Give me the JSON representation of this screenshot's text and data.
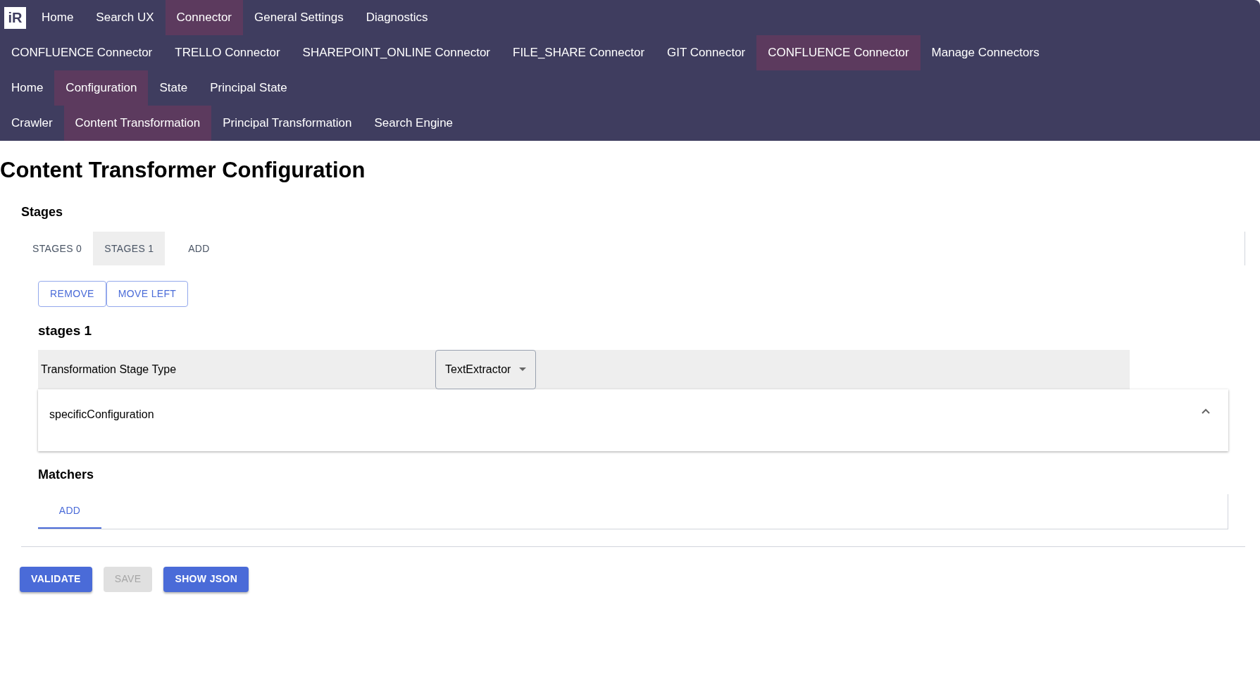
{
  "logo": {
    "text": "iR"
  },
  "nav_rows": [
    [
      {
        "label": "Home",
        "selected": false
      },
      {
        "label": "Search UX",
        "selected": false
      },
      {
        "label": "Connector",
        "selected": true
      },
      {
        "label": "General Settings",
        "selected": false
      },
      {
        "label": "Diagnostics",
        "selected": false
      }
    ],
    [
      {
        "label": "CONFLUENCE Connector",
        "selected": false
      },
      {
        "label": "TRELLO Connector",
        "selected": false
      },
      {
        "label": "SHAREPOINT_ONLINE Connector",
        "selected": false
      },
      {
        "label": "FILE_SHARE Connector",
        "selected": false
      },
      {
        "label": "GIT Connector",
        "selected": false
      },
      {
        "label": "CONFLUENCE Connector",
        "selected": true
      },
      {
        "label": "Manage Connectors",
        "selected": false
      }
    ],
    [
      {
        "label": "Home",
        "selected": false
      },
      {
        "label": "Configuration",
        "selected": true
      },
      {
        "label": "State",
        "selected": false
      },
      {
        "label": "Principal State",
        "selected": false
      }
    ],
    [
      {
        "label": "Crawler",
        "selected": false
      },
      {
        "label": "Content Transformation",
        "selected": true
      },
      {
        "label": "Principal Transformation",
        "selected": false
      },
      {
        "label": "Search Engine",
        "selected": false
      }
    ]
  ],
  "page_title": "Content Transformer Configuration",
  "stages": {
    "heading": "Stages",
    "tabs": [
      {
        "label": "STAGES 0",
        "selected": false
      },
      {
        "label": "STAGES 1",
        "selected": true
      },
      {
        "label": "ADD",
        "selected": false
      }
    ],
    "actions": [
      "REMOVE",
      "MOVE LEFT"
    ],
    "stage_title": "stages 1",
    "field_label": "Transformation Stage Type",
    "select_value": "TextExtractor",
    "accordion": {
      "label": "specificConfiguration",
      "expanded": true
    }
  },
  "matchers": {
    "heading": "Matchers",
    "tabs": [
      {
        "label": "ADD",
        "selected": true
      }
    ]
  },
  "footer_buttons": [
    {
      "label": "VALIDATE",
      "disabled": false
    },
    {
      "label": "SAVE",
      "disabled": true
    },
    {
      "label": "SHOW JSON",
      "disabled": false
    }
  ]
}
